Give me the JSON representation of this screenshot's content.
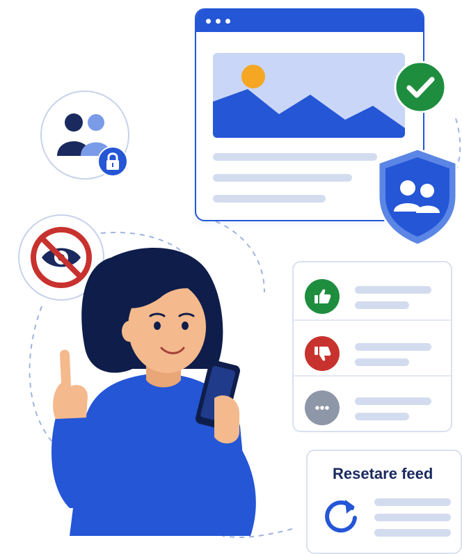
{
  "colors": {
    "primary_blue": "#2456d6",
    "navy": "#1a2a5e",
    "like_green": "#1e8e3e",
    "dislike_red": "#c8322e",
    "more_gray": "#8d97a8",
    "shield_light": "#5b86e5",
    "skin": "#f4b98c"
  },
  "icons": {
    "privacy_group": "lock-icon",
    "hidden": "eye-slash-icon",
    "verified": "check-circle-icon",
    "shield": "shield-group-icon",
    "like": "thumbs-up-icon",
    "dislike": "thumbs-down-icon",
    "more": "more-dots-icon",
    "reset": "refresh-icon"
  },
  "reset_card": {
    "title": "Resetare feed"
  }
}
